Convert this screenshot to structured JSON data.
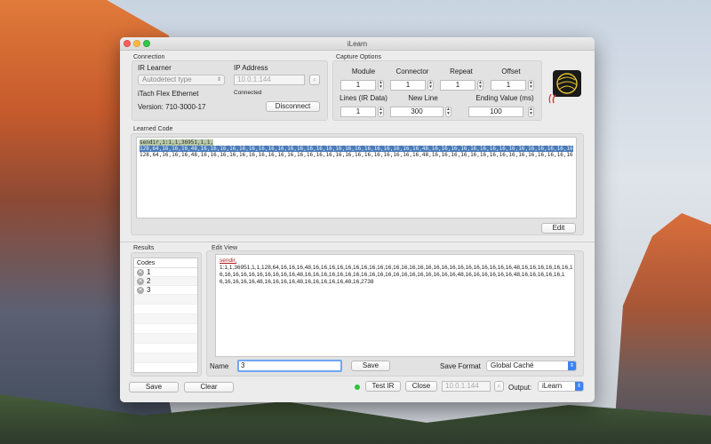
{
  "window": {
    "title": "iLearn"
  },
  "connection": {
    "group_label": "Connection",
    "ir_learner_label": "IR Learner",
    "ir_learner_value": "Autodetect type",
    "ip_label": "IP Address",
    "ip_value": "10.0.1.144",
    "status": "Connected",
    "device_name": "iTach Flex Ethernet",
    "version": "Version: 710-3000-17",
    "disconnect_label": "Disconnect"
  },
  "capture": {
    "group_label": "Capture Options",
    "module_label": "Module",
    "module_value": "1",
    "connector_label": "Connector",
    "connector_value": "1",
    "repeat_label": "Repeat",
    "repeat_value": "1",
    "offset_label": "Offset",
    "offset_value": "1",
    "lines_label": "Lines (IR Data)",
    "lines_value": "1",
    "newline_label": "New Line",
    "newline_value": "300",
    "ending_label": "Ending Value (ms)",
    "ending_value": "100"
  },
  "learned": {
    "group_label": "Learned Code",
    "line1": "sendir,1:1,1,36951,1,1,",
    "line2": "128,64,16,16,16,48,16,16,16,16,16,16,16,16,16,16,16,16,16,16,16,16,16,16,16,16,16,16,16,48,16,16,16,16,16,16,16,16,16,16,16,16,16,16,16,16,16,16,16,16,16,16,",
    "line3": "128,64,16,16,16,48,16,16,16,16,16,16,16,16,16,16,16,16,16,16,16,16,16,16,16,16,16,16,16,48,16,16,16,16,16,16,16,16,16,16,16,16,16,16,16,16,16,16,16,16,16,16,",
    "edit_label": "Edit"
  },
  "results": {
    "group_label": "Results",
    "codes_header": "Codes",
    "items": [
      "1",
      "2",
      "3"
    ]
  },
  "edit_view": {
    "group_label": "Edit View",
    "cmd": "sendir,",
    "line1": "1:1,1,36951,1,1,128,64,16,16,16,48,16,16,16,16,16,16,16,16,16,16,16,16,16,16,16,16,16,16,16,16,16,16,16,16,16,48,16,16,16,16,16,16,1",
    "line2": "6,16,16,16,16,16,16,16,16,16,48,16,16,16,16,16,16,16,16,16,16,16,16,16,16,16,16,16,16,16,48,16,16,16,16,16,16,48,16,16,16,16,16,1",
    "line3": "6,16,16,16,16,48,16,16,16,16,48,16,16,16,16,16,48,16,2738",
    "name_label": "Name",
    "name_value": "3",
    "save_label": "Save",
    "save_format_label": "Save Format",
    "save_format_value": "Global Caché"
  },
  "bottom": {
    "save_label": "Save",
    "clear_label": "Clear",
    "test_ir_label": "Test IR",
    "close_label": "Close",
    "ip_value": "10.0.1.144",
    "output_label": "Output:",
    "output_value": "iLearn"
  },
  "colors": {
    "accent": "#3b82f6",
    "status_led": "#2fc33c",
    "selection": "#4b7cb8"
  }
}
